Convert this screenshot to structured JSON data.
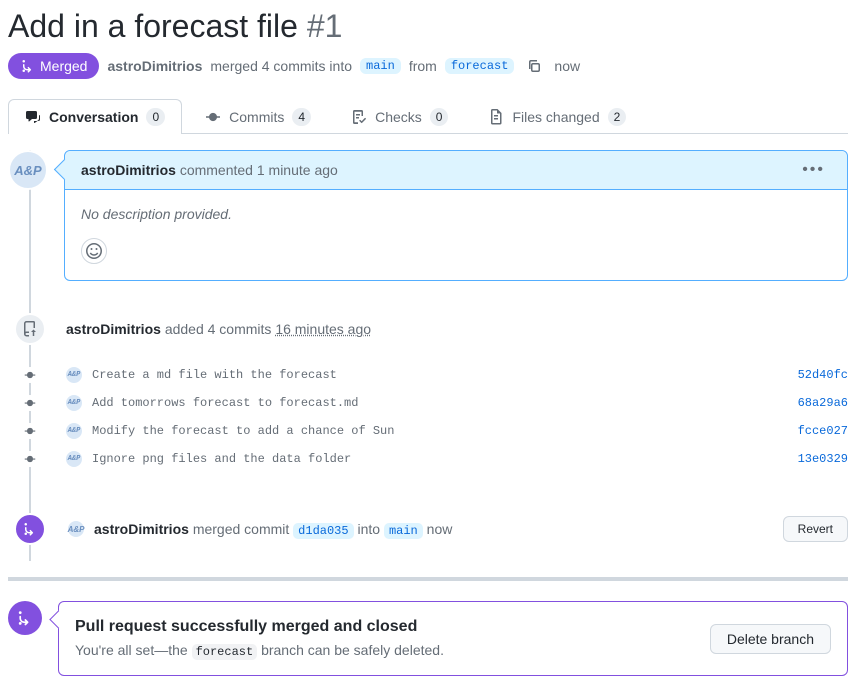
{
  "title": "Add in a forecast file",
  "issue_number": "#1",
  "merged_badge_label": "Merged",
  "author": "astroDimitrios",
  "merge_summary": "merged 4 commits into",
  "target_branch": "main",
  "from_label": "from",
  "source_branch": "forecast",
  "merged_time": "now",
  "tabs": {
    "conversation": {
      "label": "Conversation",
      "count": "0"
    },
    "commits": {
      "label": "Commits",
      "count": "4"
    },
    "checks": {
      "label": "Checks",
      "count": "0"
    },
    "files": {
      "label": "Files changed",
      "count": "2"
    }
  },
  "avatar_initials": "A&P",
  "comment": {
    "author": "astroDimitrios",
    "action": "commented",
    "time": "1 minute ago",
    "body": "No description provided."
  },
  "added_event": {
    "author": "astroDimitrios",
    "text": "added 4 commits",
    "time": "16 minutes ago"
  },
  "commits_list": [
    {
      "message": "Create a md file with the forecast",
      "sha": "52d40fc"
    },
    {
      "message": "Add tomorrows forecast to forecast.md",
      "sha": "68a29a6"
    },
    {
      "message": "Modify the forecast to add a chance of Sun",
      "sha": "fcce027"
    },
    {
      "message": "Ignore png files and the data folder",
      "sha": "13e0329"
    }
  ],
  "merge_event": {
    "author": "astroDimitrios",
    "text": "merged commit",
    "commit": "d1da035",
    "into": "into",
    "branch": "main",
    "time": "now"
  },
  "buttons": {
    "revert": "Revert",
    "delete_branch": "Delete branch"
  },
  "success_box": {
    "title": "Pull request successfully merged and closed",
    "text_before": "You're all set—the",
    "branch": "forecast",
    "text_after": "branch can be safely deleted."
  }
}
